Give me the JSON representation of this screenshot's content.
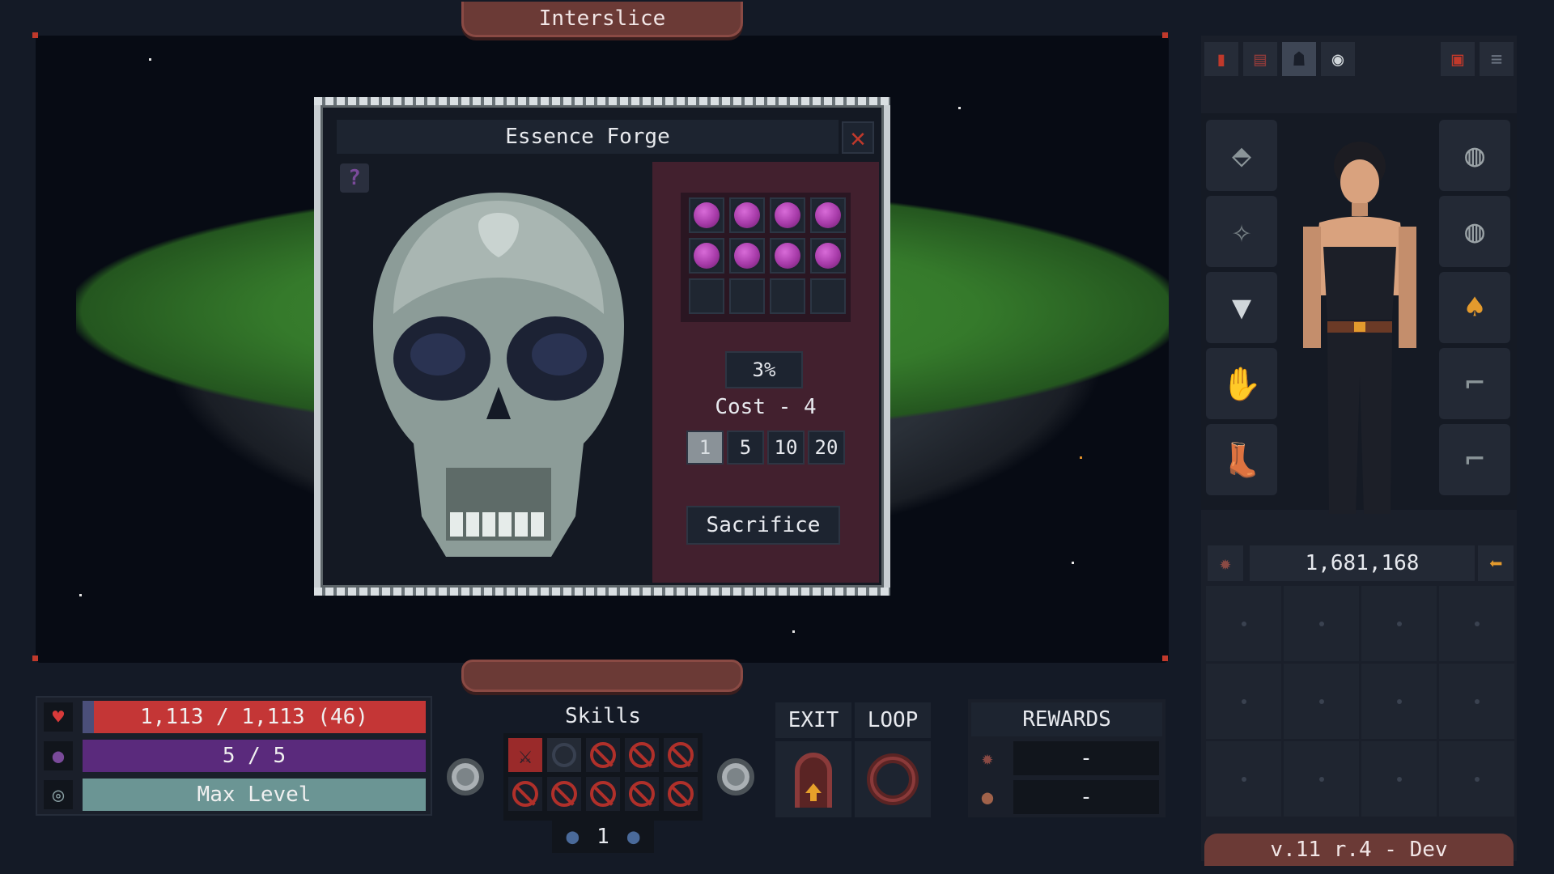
{
  "title": "Interslice",
  "modal": {
    "title": "Essence Forge",
    "close_label": "✕",
    "help_label": "?",
    "gems_filled": 8,
    "gem_slots": 12,
    "percent": "3%",
    "cost": "Cost - 4",
    "quantities": [
      "1",
      "5",
      "10",
      "20"
    ],
    "selected_quantity": "1",
    "sacrifice": "Sacrifice"
  },
  "hud": {
    "hp": "1,113 / 1,113 (46)",
    "mana": "5 / 5",
    "level": "Max Level",
    "skills_label": "Skills",
    "skill_points": "1",
    "exit": "EXIT",
    "loop": "LOOP",
    "rewards_title": "REWARDS",
    "reward_1": "-",
    "reward_2": "-"
  },
  "sidebar": {
    "gold": "1,681,168",
    "version": "v.11 r.4 - Dev"
  },
  "colors": {
    "hp": "#c43636",
    "mana": "#5a2a7c",
    "level": "#6b9594",
    "gem": "#a63aa8",
    "accent": "#6b3a36"
  }
}
